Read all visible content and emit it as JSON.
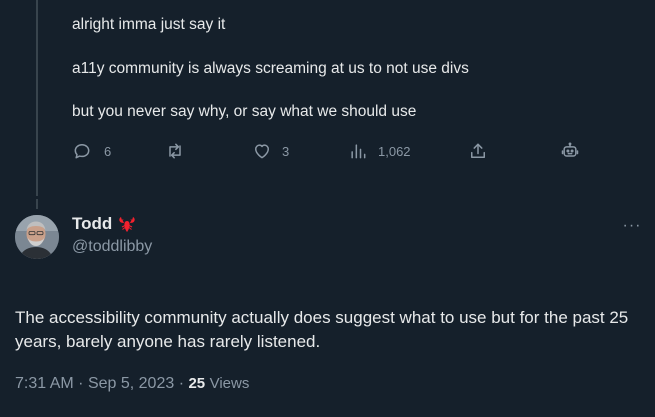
{
  "parent_tweet": {
    "lines": [
      "alright imma just say it",
      "a11y community is always screaming at us to not use divs",
      "but you never say why, or say what we should use"
    ],
    "actions": {
      "replies": "6",
      "likes": "3",
      "views": "1,062"
    }
  },
  "reply_tweet": {
    "author_name": "Todd",
    "author_badge_icon": "lobster-icon",
    "author_handle": "@toddlibby",
    "more_label": "···",
    "text": "The accessibility community actually does suggest what to use but for the past 25 years, barely anyone has rarely listened.",
    "time": "7:31 AM",
    "separator": "·",
    "date": "Sep 5, 2023",
    "views_count": "25",
    "views_label": "Views"
  },
  "colors": {
    "background": "#15202b",
    "text_primary": "#e7e9ea",
    "text_secondary": "#8b98a5",
    "thread_line": "#38444d",
    "badge": "#f4212e"
  }
}
